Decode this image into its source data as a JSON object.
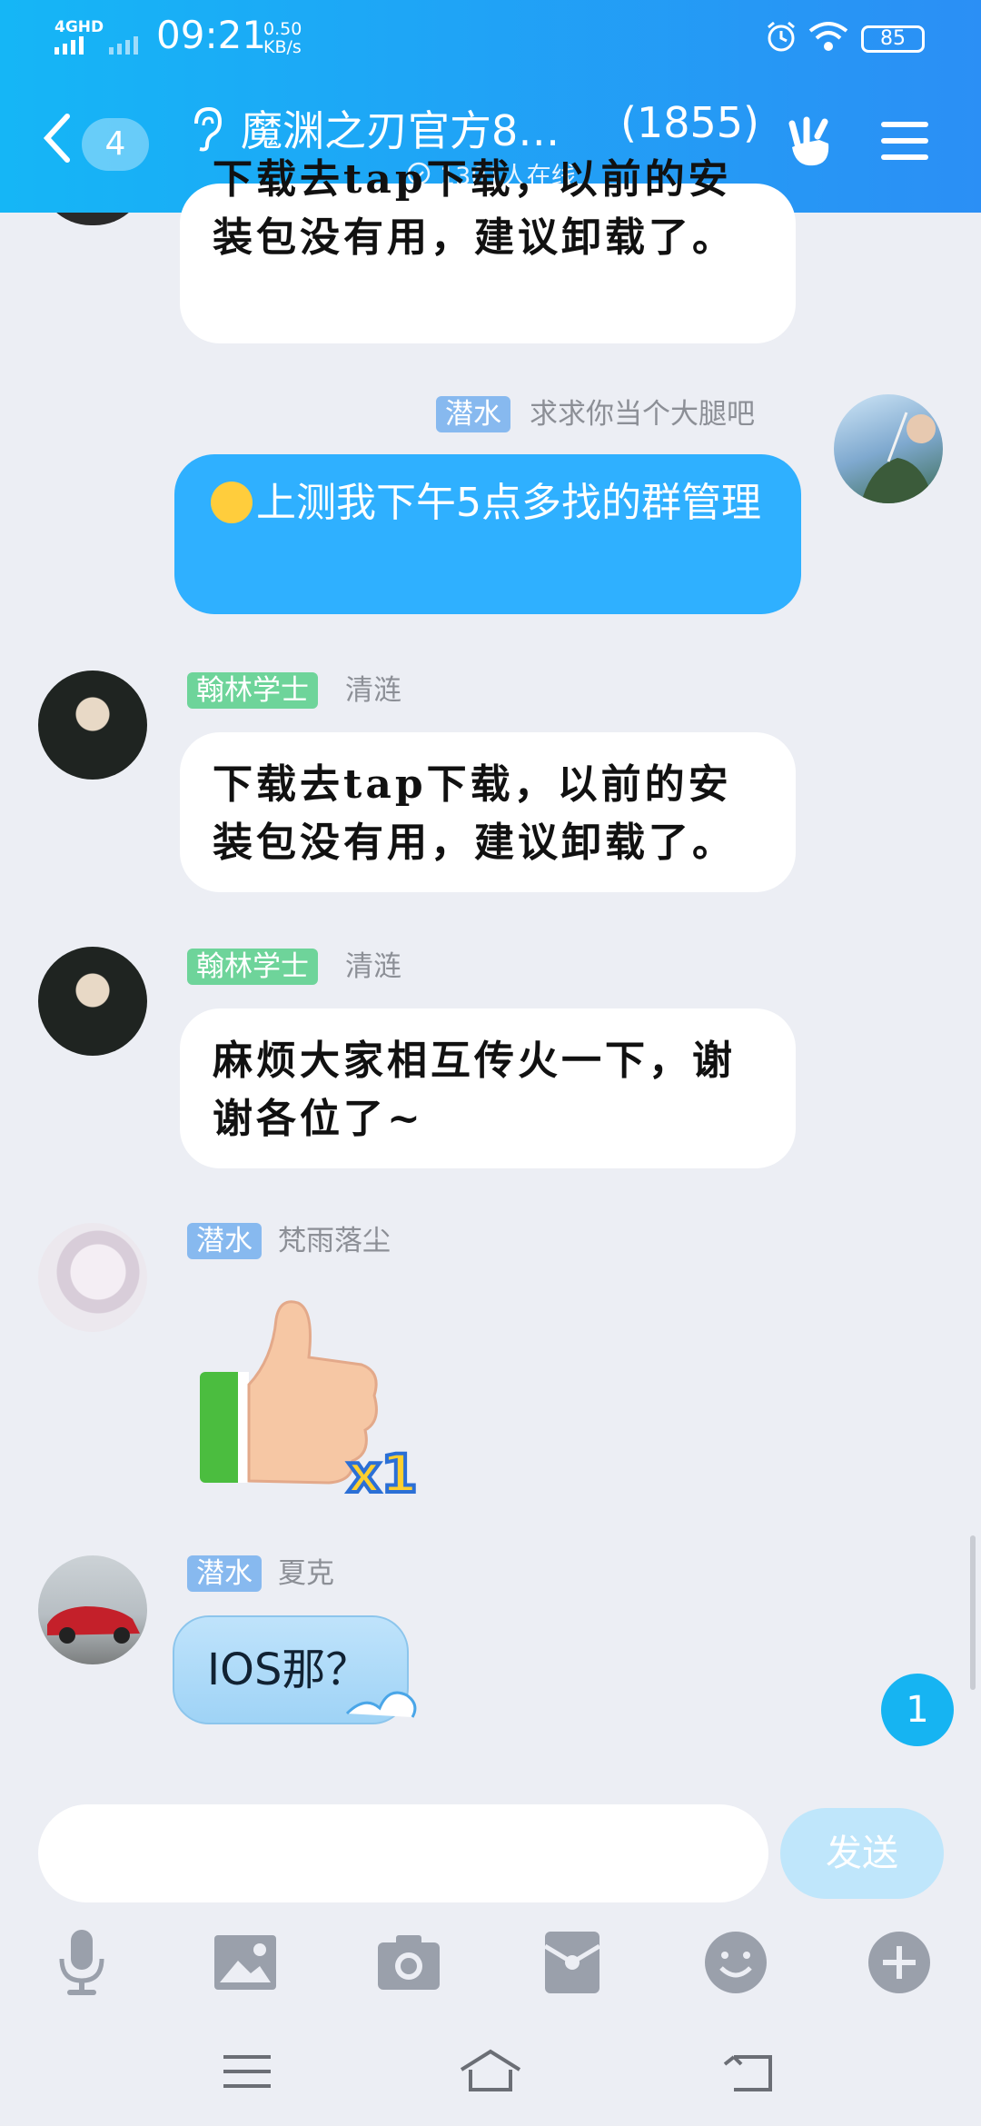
{
  "status_bar": {
    "network": "4GHD",
    "time": "09:21",
    "speed_value": "0.50",
    "speed_unit": "KB/s",
    "battery": "85"
  },
  "header": {
    "back_count": "4",
    "title": "魔渊之刃官方8…",
    "member_count": "(1855)",
    "online": "1301人在线"
  },
  "messages": [
    {
      "id": "m0",
      "text_line1": "下载去tap下载，以前的安",
      "text_line2": "装包没有用，建议卸载了。"
    },
    {
      "id": "m1",
      "self": true,
      "badge": "潜水",
      "nick": "求求你当个大腿吧",
      "text": "上测我下午5点多找的群管理"
    },
    {
      "id": "m2",
      "badge": "翰林学士",
      "nick": "清涟",
      "text_line1": "下载去tap下载，以前的安",
      "text_line2": "装包没有用，建议卸载了。"
    },
    {
      "id": "m3",
      "badge": "翰林学士",
      "nick": "清涟",
      "text_line1": "麻烦大家相互传火一下，谢",
      "text_line2": "谢各位了~"
    },
    {
      "id": "m4",
      "badge": "潜水",
      "nick": "梵雨落尘",
      "sticker": "thumbs-up",
      "sticker_text": "x1"
    },
    {
      "id": "m5",
      "badge": "潜水",
      "nick": "夏克",
      "text": "IOS那？"
    }
  ],
  "unread_count": "1",
  "input": {
    "placeholder": "",
    "send_label": "发送"
  },
  "toolbar": [
    "microphone-icon",
    "image-icon",
    "camera-icon",
    "red-packet-icon",
    "emoji-icon",
    "plus-icon"
  ],
  "colors": {
    "header_start": "#15b6f6",
    "header_end": "#2b8ff5",
    "self_bubble": "#2fb0ff",
    "background": "#eceef4"
  }
}
